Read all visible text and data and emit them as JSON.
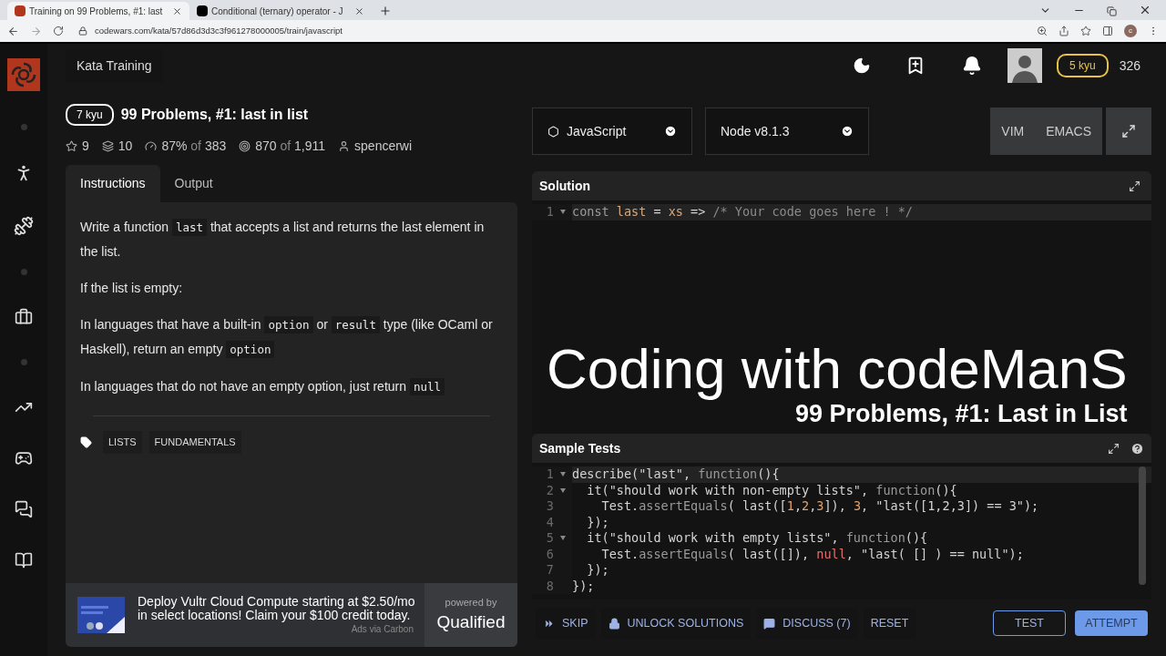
{
  "browser": {
    "tabs": [
      {
        "title": "Training on 99 Problems, #1: last",
        "kind": "codewars",
        "selected": true
      },
      {
        "title": "Conditional (ternary) operator - J",
        "kind": "mdn",
        "selected": false
      }
    ],
    "url": "codewars.com/kata/57d86d3d3c3f961278000005/train/javascript",
    "profile": "c"
  },
  "nav": {
    "title": "Kata Training",
    "rank": "5 kyu",
    "honor": "326"
  },
  "kata": {
    "rank": "7 kyu",
    "title": "99 Problems, #1: last in list",
    "stats": [
      {
        "kind": "stars",
        "value": "9"
      },
      {
        "kind": "collections",
        "value": "10"
      },
      {
        "kind": "satisfaction",
        "value": "87%",
        "of": "of",
        "total": "383"
      },
      {
        "kind": "completed",
        "value": "870",
        "of": "of",
        "total": "1,911"
      },
      {
        "kind": "author",
        "value": "spencerwi"
      }
    ]
  },
  "tabs": [
    {
      "label": "Instructions",
      "selected": true
    },
    {
      "label": "Output",
      "selected": false
    }
  ],
  "instructions": [
    [
      {
        "kind": "text",
        "text": "Write a function "
      },
      {
        "kind": "code",
        "text": "last"
      },
      {
        "kind": "text",
        "text": " that accepts a list and returns the last element in the list."
      }
    ],
    [
      {
        "kind": "text",
        "text": "If the list is empty:"
      }
    ],
    [
      {
        "kind": "text",
        "text": "In languages that have a built-in "
      },
      {
        "kind": "code",
        "text": "option"
      },
      {
        "kind": "text",
        "text": " or "
      },
      {
        "kind": "code",
        "text": "result"
      },
      {
        "kind": "text",
        "text": " type (like OCaml or Haskell), return an empty "
      },
      {
        "kind": "code",
        "text": "option"
      }
    ],
    [
      {
        "kind": "text",
        "text": "In languages that do not have an empty option, just return "
      },
      {
        "kind": "code",
        "text": "null"
      }
    ]
  ],
  "tags": [
    "LISTS",
    "FUNDAMENTALS"
  ],
  "ad": {
    "text": "Deploy Vultr Cloud Compute starting at $2.50/mo in select locations! Claim your $100 credit today.",
    "via": "Ads via Carbon",
    "powered_by": "powered by",
    "brand": "Qualified"
  },
  "editor": {
    "language": "JavaScript",
    "runtime": "Node v8.1.3",
    "modes": [
      "VIM",
      "EMACS"
    ]
  },
  "solution": {
    "title": "Solution",
    "lines": [
      {
        "number": "1",
        "fold": true,
        "active": true,
        "tokens": [
          {
            "kind": "k",
            "text": "const "
          },
          {
            "kind": "v",
            "text": "last"
          },
          {
            "kind": "p",
            "text": " = "
          },
          {
            "kind": "v",
            "text": "xs"
          },
          {
            "kind": "p",
            "text": " => "
          },
          {
            "kind": "c",
            "text": "/* Your code goes here ! */"
          }
        ]
      }
    ]
  },
  "sample_tests": {
    "title": "Sample Tests",
    "lines": [
      {
        "number": "1",
        "fold": true,
        "active": true,
        "tokens": [
          {
            "kind": "p",
            "text": "describe(\"last\", "
          },
          {
            "kind": "k",
            "text": "function"
          },
          {
            "kind": "p",
            "text": "(){"
          }
        ]
      },
      {
        "number": "2",
        "fold": true,
        "active": false,
        "tokens": [
          {
            "kind": "p",
            "text": "  it(\"should work with non-empty lists\", "
          },
          {
            "kind": "k",
            "text": "function"
          },
          {
            "kind": "p",
            "text": "(){"
          }
        ]
      },
      {
        "number": "3",
        "fold": false,
        "active": false,
        "tokens": [
          {
            "kind": "p",
            "text": "    Test."
          },
          {
            "kind": "k",
            "text": "assertEquals"
          },
          {
            "kind": "p",
            "text": "( last(["
          },
          {
            "kind": "n",
            "text": "1"
          },
          {
            "kind": "p",
            "text": ","
          },
          {
            "kind": "n",
            "text": "2"
          },
          {
            "kind": "p",
            "text": ","
          },
          {
            "kind": "n",
            "text": "3"
          },
          {
            "kind": "p",
            "text": "]), "
          },
          {
            "kind": "n",
            "text": "3"
          },
          {
            "kind": "p",
            "text": ", \"last([1,2,3]) == 3\");"
          }
        ]
      },
      {
        "number": "4",
        "fold": false,
        "active": false,
        "tokens": [
          {
            "kind": "p",
            "text": "  });"
          }
        ]
      },
      {
        "number": "5",
        "fold": true,
        "active": false,
        "tokens": [
          {
            "kind": "p",
            "text": "  it(\"should work with empty lists\", "
          },
          {
            "kind": "k",
            "text": "function"
          },
          {
            "kind": "p",
            "text": "(){"
          }
        ]
      },
      {
        "number": "6",
        "fold": false,
        "active": false,
        "tokens": [
          {
            "kind": "p",
            "text": "    Test."
          },
          {
            "kind": "k",
            "text": "assertEquals"
          },
          {
            "kind": "p",
            "text": "( last([]), "
          },
          {
            "kind": "x",
            "text": "null"
          },
          {
            "kind": "p",
            "text": ", \"last( [] ) == null\");"
          }
        ]
      },
      {
        "number": "7",
        "fold": false,
        "active": false,
        "tokens": [
          {
            "kind": "p",
            "text": "  });"
          }
        ]
      },
      {
        "number": "8",
        "fold": false,
        "active": false,
        "tokens": [
          {
            "kind": "p",
            "text": "});"
          }
        ]
      }
    ]
  },
  "actions": [
    {
      "kind": "skip",
      "label": "SKIP"
    },
    {
      "kind": "unlock",
      "label": "UNLOCK SOLUTIONS"
    },
    {
      "kind": "discuss",
      "label": "DISCUSS (7)"
    },
    {
      "kind": "reset",
      "label": "RESET"
    }
  ],
  "submit": [
    {
      "kind": "outline",
      "label": "TEST"
    },
    {
      "kind": "primary",
      "label": "ATTEMPT"
    }
  ],
  "overlay": {
    "title": "Coding with codeManS",
    "subtitle": "99 Problems, #1: Last in List"
  }
}
